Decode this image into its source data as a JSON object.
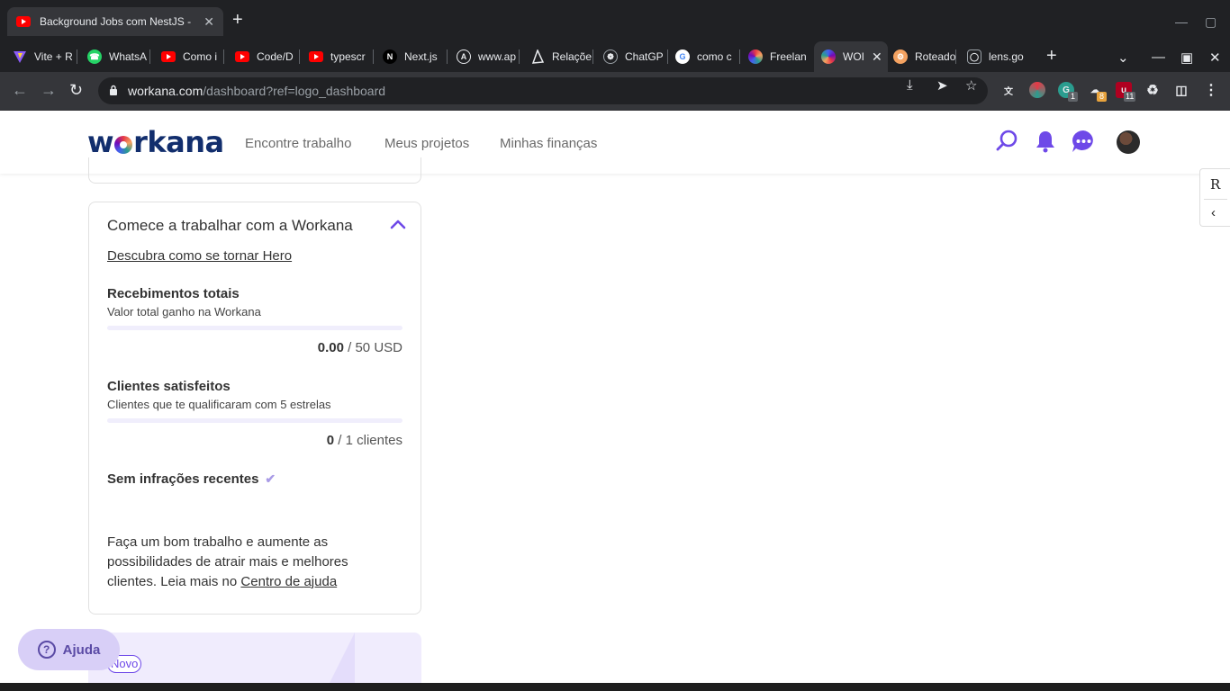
{
  "window": {
    "tab_title": "Background Jobs com NestJS - ",
    "close_symbol": "✕",
    "new_tab_symbol": "+"
  },
  "tabs": [
    {
      "label": "Vite + R",
      "icon": "vite-icon",
      "color": "#8b5cf6"
    },
    {
      "label": "WhatsA",
      "icon": "whatsapp-icon",
      "color": "#25d366"
    },
    {
      "label": "Como i",
      "icon": "youtube-icon",
      "color": "#ff0000"
    },
    {
      "label": "Code/D",
      "icon": "youtube-icon",
      "color": "#ff0000"
    },
    {
      "label": "typescr",
      "icon": "youtube-icon",
      "color": "#ff0000"
    },
    {
      "label": "Next.js",
      "icon": "nextjs-icon",
      "color": "#000000"
    },
    {
      "label": "www.ap",
      "icon": "web-icon",
      "color": "#e8eaed"
    },
    {
      "label": "Relaçõe",
      "icon": "prisma-icon",
      "color": "#e8eaed"
    },
    {
      "label": "ChatGP",
      "icon": "chatgpt-icon",
      "color": "#74aa9c"
    },
    {
      "label": "como c",
      "icon": "google-icon",
      "color": "#4285f4"
    },
    {
      "label": "Freelan",
      "icon": "workana-icon",
      "color": "#e63946"
    },
    {
      "label": "WOI",
      "icon": "workana-icon",
      "color": "#4361ee",
      "active": true
    },
    {
      "label": "Roteado",
      "icon": "router-icon",
      "color": "#f4a261"
    },
    {
      "label": "lens.go",
      "icon": "lens-icon",
      "color": "#e8eaed"
    }
  ],
  "toolbar": {
    "url_host": "workana.com",
    "url_path": "/dashboard?ref=logo_dashboard",
    "badges": [
      "1",
      "8",
      "11"
    ]
  },
  "site": {
    "logo_text_1": "w",
    "logo_text_2": "rkana",
    "nav": [
      "Encontre trabalho",
      "Meus projetos",
      "Minhas finanças"
    ]
  },
  "card": {
    "title": "Comece a trabalhar com a Workana",
    "hero_link": "Descubra como se tornar Hero",
    "receipts": {
      "title": "Recebimentos totais",
      "subtitle": "Valor total ganho na Workana",
      "current": "0.00",
      "separator": " / ",
      "target": "50 USD",
      "progress": 0
    },
    "clients": {
      "title": "Clientes satisfeitos",
      "subtitle": "Clientes que te qualificaram com 5 estrelas",
      "current": "0",
      "separator": " / ",
      "target": "1 clientes",
      "progress": 0
    },
    "infractions": "Sem infrações recentes",
    "paragraph_text": "Faça um bom trabalho e aumente as possibilidades de atrair mais e melhores clientes. Leia mais no ",
    "help_center_link": "Centro de ajuda"
  },
  "promo": {
    "badge": "Novo"
  },
  "help_button": {
    "label": "Ajuda",
    "icon_glyph": "?"
  },
  "side_widget": {
    "letter": "R",
    "chevron": "‹"
  },
  "colors": {
    "brand_purple": "#6e49e8",
    "logo_navy": "#122e6d"
  }
}
